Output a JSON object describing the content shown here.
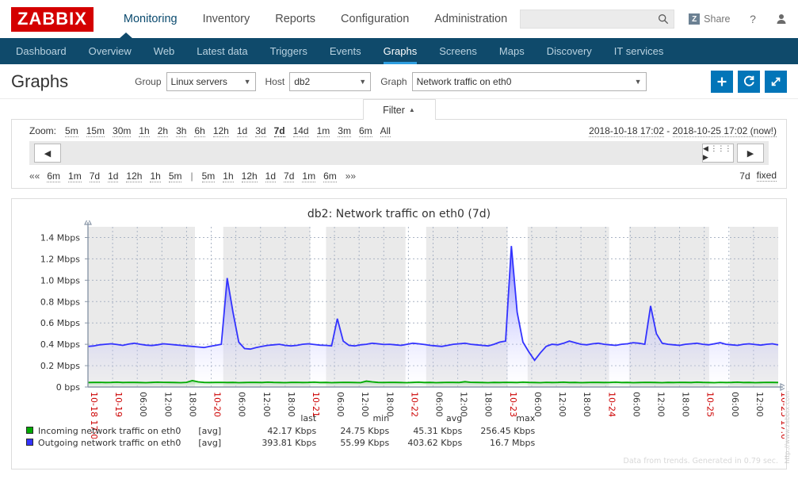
{
  "brand": {
    "logo": "ZABBIX"
  },
  "header": {
    "nav": [
      {
        "label": "Monitoring",
        "active": true
      },
      {
        "label": "Inventory",
        "active": false
      },
      {
        "label": "Reports",
        "active": false
      },
      {
        "label": "Configuration",
        "active": false
      },
      {
        "label": "Administration",
        "active": false
      }
    ],
    "search": {
      "value": "",
      "placeholder": ""
    },
    "share_label": "Share",
    "share_badge": "Z",
    "icons": [
      "search-icon",
      "help-icon",
      "user-icon",
      "power-icon"
    ]
  },
  "subnav": [
    {
      "label": "Dashboard",
      "active": false
    },
    {
      "label": "Overview",
      "active": false
    },
    {
      "label": "Web",
      "active": false
    },
    {
      "label": "Latest data",
      "active": false
    },
    {
      "label": "Triggers",
      "active": false
    },
    {
      "label": "Events",
      "active": false
    },
    {
      "label": "Graphs",
      "active": true
    },
    {
      "label": "Screens",
      "active": false
    },
    {
      "label": "Maps",
      "active": false
    },
    {
      "label": "Discovery",
      "active": false
    },
    {
      "label": "IT services",
      "active": false
    }
  ],
  "page": {
    "title": "Graphs",
    "group_label": "Group",
    "group_value": "Linux servers",
    "host_label": "Host",
    "host_value": "db2",
    "graph_label": "Graph",
    "graph_value": "Network traffic on eth0",
    "buttons": {
      "add": "+",
      "refresh": "⟳",
      "fullscreen": "⤢"
    }
  },
  "filter": {
    "tab_label": "Filter",
    "tab_caret": "▲",
    "zoom_label": "Zoom:",
    "zoom_options": [
      "5m",
      "15m",
      "30m",
      "1h",
      "2h",
      "3h",
      "6h",
      "12h",
      "1d",
      "3d",
      "7d",
      "14d",
      "1m",
      "3m",
      "6m",
      "All"
    ],
    "zoom_selected": "7d",
    "date_from": "2018-10-18 17:02",
    "date_sep": "-",
    "date_to": "2018-10-25 17:02 (now!)",
    "nav_left": "◀",
    "nav_right": "▶",
    "drag_handle": "◀ ⋮⋮⋮ ▶",
    "shortcuts_prev_icon": "««",
    "shortcuts_prev": [
      "6m",
      "1m",
      "7d",
      "1d",
      "12h",
      "1h",
      "5m"
    ],
    "divider": "|",
    "shortcuts_next": [
      "5m",
      "1h",
      "12h",
      "1d",
      "7d",
      "1m",
      "6m"
    ],
    "shortcuts_next_icon": "»»",
    "period_label": "7d",
    "fixed_label": "fixed"
  },
  "chart_data": {
    "type": "area",
    "title": "db2: Network traffic on eth0 (7d)",
    "xlabel": "",
    "ylabel": "",
    "ylim": [
      0,
      1500000
    ],
    "ytick_labels": [
      "1.4 Mbps",
      "1.2 Mbps",
      "1.0 Mbps",
      "0.8 Mbps",
      "0.6 Mbps",
      "0.4 Mbps",
      "0.2 Mbps",
      "0 bps"
    ],
    "ytick_values": [
      1400000,
      1200000,
      1000000,
      800000,
      600000,
      400000,
      200000,
      0
    ],
    "grid": true,
    "legend_position": "bottom",
    "xtick_labels": [
      "10-18 17:02",
      "10-19",
      "06:00",
      "12:00",
      "18:00",
      "10-20",
      "06:00",
      "12:00",
      "18:00",
      "10-21",
      "06:00",
      "12:00",
      "18:00",
      "10-22",
      "06:00",
      "12:00",
      "18:00",
      "10-23",
      "06:00",
      "12:00",
      "18:00",
      "10-24",
      "06:00",
      "12:00",
      "18:00",
      "10-25",
      "06:00",
      "12:00",
      "10-25 17:02"
    ],
    "xtick_day_flags": [
      true,
      true,
      false,
      false,
      false,
      true,
      false,
      false,
      false,
      true,
      false,
      false,
      false,
      true,
      false,
      false,
      false,
      true,
      false,
      false,
      false,
      true,
      false,
      false,
      false,
      true,
      false,
      false,
      true
    ],
    "series": [
      {
        "name": "Incoming network traffic on eth0",
        "color": "#00aa00",
        "aggregate": "[avg]",
        "last": "42.17 Kbps",
        "min": "24.75 Kbps",
        "avg": "45.31 Kbps",
        "max": "256.45 Kbps",
        "values": [
          42000,
          43000,
          44000,
          42000,
          43000,
          45000,
          42000,
          44000,
          43000,
          42000,
          41000,
          43000,
          45000,
          44000,
          43000,
          42000,
          41000,
          44000,
          60000,
          48000,
          43000,
          42000,
          43000,
          44000,
          42000,
          43000,
          41000,
          42000,
          44000,
          43000,
          42000,
          45000,
          43000,
          42000,
          41000,
          43000,
          44000,
          42000,
          43000,
          45000,
          42000,
          43000,
          41000,
          42000,
          44000,
          43000,
          42000,
          41000,
          55000,
          48000,
          43000,
          42000,
          44000,
          43000,
          42000,
          41000,
          43000,
          45000,
          42000,
          43000,
          41000,
          42000,
          44000,
          43000,
          42000,
          50000,
          44000,
          43000,
          42000,
          41000,
          43000,
          42000,
          44000,
          43000,
          42000,
          45000,
          43000,
          42000,
          41000,
          44000,
          42000,
          43000,
          45000,
          42000,
          43000,
          41000,
          42000,
          44000,
          43000,
          42000,
          43000,
          45000,
          42000,
          43000,
          41000,
          42000,
          44000,
          43000,
          42000,
          41000,
          43000,
          42000,
          44000,
          43000,
          42000,
          45000,
          43000,
          42000,
          41000,
          44000,
          42000,
          43000,
          45000,
          42000,
          43000,
          41000,
          42000,
          44000,
          43000,
          42000
        ]
      },
      {
        "name": "Outgoing network traffic on eth0",
        "color": "#3333ff",
        "aggregate": "[avg]",
        "last": "393.81 Kbps",
        "min": "55.99 Kbps",
        "avg": "403.62 Kbps",
        "max": "16.7 Mbps",
        "values": [
          380000,
          385000,
          395000,
          400000,
          405000,
          398000,
          390000,
          402000,
          410000,
          400000,
          392000,
          388000,
          395000,
          405000,
          400000,
          395000,
          390000,
          385000,
          380000,
          375000,
          370000,
          380000,
          390000,
          400000,
          1020000,
          700000,
          420000,
          360000,
          355000,
          370000,
          380000,
          390000,
          395000,
          400000,
          390000,
          385000,
          390000,
          400000,
          405000,
          398000,
          392000,
          390000,
          385000,
          640000,
          430000,
          390000,
          385000,
          395000,
          400000,
          410000,
          405000,
          398000,
          400000,
          395000,
          390000,
          400000,
          410000,
          405000,
          398000,
          390000,
          385000,
          380000,
          390000,
          400000,
          405000,
          410000,
          400000,
          395000,
          390000,
          385000,
          400000,
          420000,
          430000,
          1320000,
          700000,
          420000,
          330000,
          250000,
          320000,
          380000,
          400000,
          395000,
          410000,
          430000,
          415000,
          400000,
          395000,
          405000,
          410000,
          400000,
          395000,
          390000,
          400000,
          405000,
          415000,
          410000,
          400000,
          760000,
          500000,
          410000,
          400000,
          395000,
          390000,
          400000,
          405000,
          410000,
          400000,
          395000,
          405000,
          415000,
          400000,
          395000,
          390000,
          400000,
          405000,
          398000,
          392000,
          400000,
          405000,
          394000
        ]
      }
    ],
    "working_time_bands": [
      [
        0.0,
        0.155
      ],
      [
        0.196,
        0.322
      ],
      [
        0.345,
        0.46
      ],
      [
        0.49,
        0.608
      ],
      [
        0.637,
        0.755
      ],
      [
        0.784,
        0.9
      ],
      [
        0.93,
        1.0
      ]
    ],
    "legend_headers": [
      "last",
      "min",
      "avg",
      "max"
    ]
  },
  "graph": {
    "watermark": "http://www.zabbix.com",
    "footnote": "Data from trends. Generated in 0.79 sec."
  }
}
